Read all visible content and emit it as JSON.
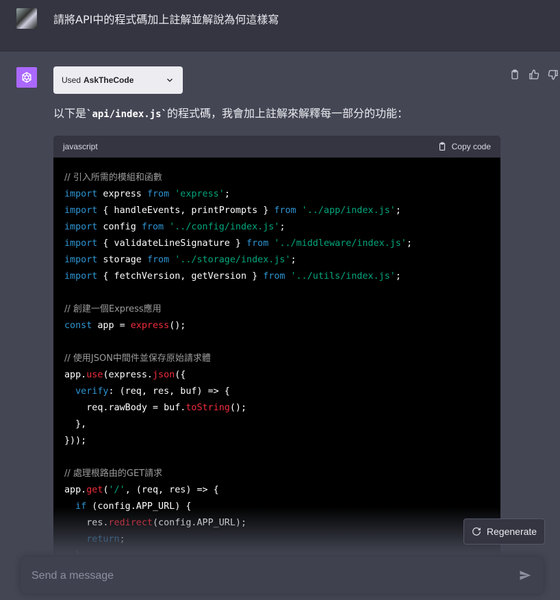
{
  "user": {
    "message": "請將API中的程式碼加上註解並解說為何這樣寫"
  },
  "assistant": {
    "plugin_prefix": "Used",
    "plugin_name": "AskTheCode",
    "intro_before": "以下是",
    "intro_code": "`api/index.js`",
    "intro_after": "的程式碼，我會加上註解來解釋每一部分的功能："
  },
  "code_block": {
    "language": "javascript",
    "copy_label": "Copy code"
  },
  "regenerate_label": "Regenerate",
  "composer": {
    "placeholder": "Send a message"
  },
  "icons": [
    "openai-logo-icon",
    "chevron-down-icon",
    "clipboard-icon",
    "thumbs-up-icon",
    "thumbs-down-icon",
    "refresh-icon",
    "send-icon"
  ],
  "colors": {
    "background": "#444654",
    "user_row": "#343541",
    "logo": "#ab68ff",
    "keyword": "#2e95d3",
    "string": "#00a67d",
    "function": "#f22c3d"
  }
}
